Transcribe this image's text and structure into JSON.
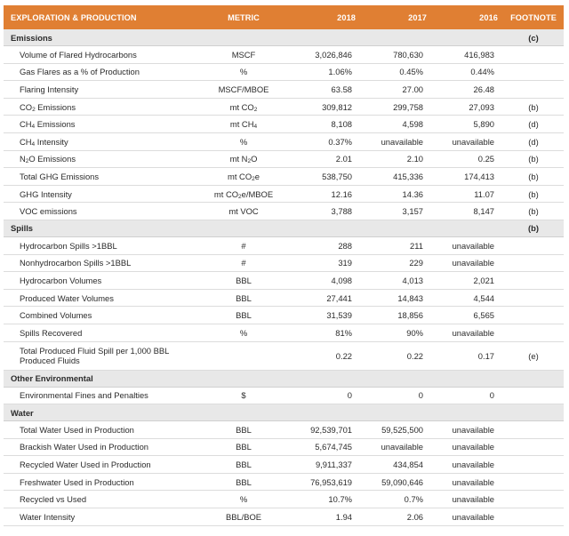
{
  "header": {
    "segment": "EXPLORATION & PRODUCTION",
    "metric": "METRIC",
    "years": [
      "2018",
      "2017",
      "2016"
    ],
    "footnote": "FOOTNOTE"
  },
  "sections": [
    {
      "title": "Emissions",
      "footnote": "(c)",
      "rows": [
        {
          "label": "Volume of Flared Hydrocarbons",
          "metric": "MSCF",
          "v2018": "3,026,846",
          "v2017": "780,630",
          "v2016": "416,983",
          "footnote": ""
        },
        {
          "label": "Gas Flares as a % of Production",
          "metric": "%",
          "v2018": "1.06%",
          "v2017": "0.45%",
          "v2016": "0.44%",
          "footnote": ""
        },
        {
          "label": "Flaring Intensity",
          "metric": "MSCF/MBOE",
          "v2018": "63.58",
          "v2017": "27.00",
          "v2016": "26.48",
          "footnote": ""
        },
        {
          "label": "CO2 Emissions",
          "metric": "mt CO2",
          "v2018": "309,812",
          "v2017": "299,758",
          "v2016": "27,093",
          "footnote": "(b)"
        },
        {
          "label": "CH4 Emissions",
          "metric": "mt CH4",
          "v2018": "8,108",
          "v2017": "4,598",
          "v2016": "5,890",
          "footnote": "(d)"
        },
        {
          "label": "CH4 Intensity",
          "metric": "%",
          "v2018": "0.37%",
          "v2017": "unavailable",
          "v2016": "unavailable",
          "footnote": "(d)"
        },
        {
          "label": "N2O Emissions",
          "metric": "mt N2O",
          "v2018": "2.01",
          "v2017": "2.10",
          "v2016": "0.25",
          "footnote": "(b)"
        },
        {
          "label": "Total GHG Emissions",
          "metric": "mt CO2e",
          "v2018": "538,750",
          "v2017": "415,336",
          "v2016": "174,413",
          "footnote": "(b)"
        },
        {
          "label": "GHG Intensity",
          "metric": "mt CO2e/MBOE",
          "v2018": "12.16",
          "v2017": "14.36",
          "v2016": "11.07",
          "footnote": "(b)"
        },
        {
          "label": "VOC emissions",
          "metric": "mt VOC",
          "v2018": "3,788",
          "v2017": "3,157",
          "v2016": "8,147",
          "footnote": "(b)"
        }
      ]
    },
    {
      "title": "Spills",
      "footnote": "(b)",
      "rows": [
        {
          "label": "Hydrocarbon Spills >1BBL",
          "metric": "#",
          "v2018": "288",
          "v2017": "211",
          "v2016": "unavailable",
          "footnote": ""
        },
        {
          "label": "Nonhydrocarbon Spills >1BBL",
          "metric": "#",
          "v2018": "319",
          "v2017": "229",
          "v2016": "unavailable",
          "footnote": ""
        },
        {
          "label": "Hydrocarbon Volumes",
          "metric": "BBL",
          "v2018": "4,098",
          "v2017": "4,013",
          "v2016": "2,021",
          "footnote": ""
        },
        {
          "label": "Produced Water Volumes",
          "metric": "BBL",
          "v2018": "27,441",
          "v2017": "14,843",
          "v2016": "4,544",
          "footnote": ""
        },
        {
          "label": "Combined Volumes",
          "metric": "BBL",
          "v2018": "31,539",
          "v2017": "18,856",
          "v2016": "6,565",
          "footnote": ""
        },
        {
          "label": "Spills Recovered",
          "metric": "%",
          "v2018": "81%",
          "v2017": "90%",
          "v2016": "unavailable",
          "footnote": ""
        },
        {
          "label": "Total Produced Fluid Spill per 1,000 BBL\nProduced Fluids",
          "metric": "",
          "v2018": "0.22",
          "v2017": "0.22",
          "v2016": "0.17",
          "footnote": "(e)"
        }
      ]
    },
    {
      "title": "Other Environmental",
      "footnote": "",
      "rows": [
        {
          "label": "Environmental Fines and Penalties",
          "metric": "$",
          "v2018": "0",
          "v2017": "0",
          "v2016": "0",
          "footnote": ""
        }
      ]
    },
    {
      "title": "Water",
      "footnote": "",
      "rows": [
        {
          "label": "Total Water Used in Production",
          "metric": "BBL",
          "v2018": "92,539,701",
          "v2017": "59,525,500",
          "v2016": "unavailable",
          "footnote": ""
        },
        {
          "label": "Brackish Water Used in Production",
          "metric": "BBL",
          "v2018": "5,674,745",
          "v2017": "unavailable",
          "v2016": "unavailable",
          "footnote": ""
        },
        {
          "label": "Recycled Water Used in Production",
          "metric": "BBL",
          "v2018": "9,911,337",
          "v2017": "434,854",
          "v2016": "unavailable",
          "footnote": ""
        },
        {
          "label": "Freshwater Used in Production",
          "metric": "BBL",
          "v2018": "76,953,619",
          "v2017": "59,090,646",
          "v2016": "unavailable",
          "footnote": ""
        },
        {
          "label": "Recycled vs Used",
          "metric": "%",
          "v2018": "10.7%",
          "v2017": "0.7%",
          "v2016": "unavailable",
          "footnote": ""
        },
        {
          "label": "Water Intensity",
          "metric": "BBL/BOE",
          "v2018": "1.94",
          "v2017": "2.06",
          "v2016": "unavailable",
          "footnote": ""
        }
      ]
    }
  ]
}
